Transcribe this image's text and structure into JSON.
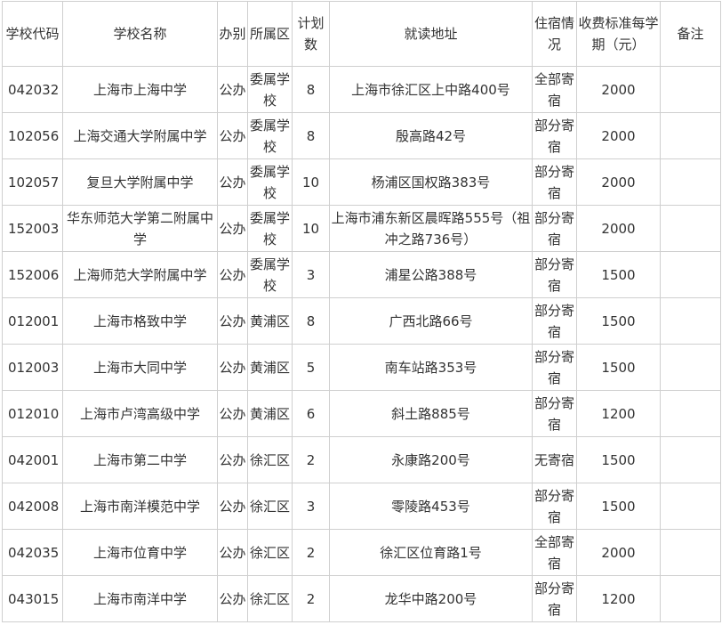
{
  "headers": {
    "code": "学校代码",
    "name": "学校名称",
    "type": "办别",
    "district": "所属区",
    "plan": "计划数",
    "address": "就读地址",
    "boarding": "住宿情况",
    "fee": "收费标准每学期（元）",
    "remark": "备注"
  },
  "rows": [
    {
      "code": "042032",
      "name": "上海市上海中学",
      "type": "公办",
      "district": "委属学校",
      "plan": "8",
      "address": "上海市徐汇区上中路400号",
      "boarding": "全部寄宿",
      "fee": "2000",
      "remark": ""
    },
    {
      "code": "102056",
      "name": "上海交通大学附属中学",
      "type": "公办",
      "district": "委属学校",
      "plan": "8",
      "address": "殷高路42号",
      "boarding": "部分寄宿",
      "fee": "2000",
      "remark": ""
    },
    {
      "code": "102057",
      "name": "复旦大学附属中学",
      "type": "公办",
      "district": "委属学校",
      "plan": "10",
      "address": "杨浦区国权路383号",
      "boarding": "部分寄宿",
      "fee": "2000",
      "remark": ""
    },
    {
      "code": "152003",
      "name": "华东师范大学第二附属中学",
      "type": "公办",
      "district": "委属学校",
      "plan": "10",
      "address": "上海市浦东新区晨晖路555号（祖冲之路736号）",
      "boarding": "部分寄宿",
      "fee": "2000",
      "remark": ""
    },
    {
      "code": "152006",
      "name": "上海师范大学附属中学",
      "type": "公办",
      "district": "委属学校",
      "plan": "3",
      "address": "浦星公路388号",
      "boarding": "部分寄宿",
      "fee": "1500",
      "remark": ""
    },
    {
      "code": "012001",
      "name": "上海市格致中学",
      "type": "公办",
      "district": "黄浦区",
      "plan": "8",
      "address": "广西北路66号",
      "boarding": "部分寄宿",
      "fee": "1500",
      "remark": ""
    },
    {
      "code": "012003",
      "name": "上海市大同中学",
      "type": "公办",
      "district": "黄浦区",
      "plan": "5",
      "address": "南车站路353号",
      "boarding": "部分寄宿",
      "fee": "1500",
      "remark": ""
    },
    {
      "code": "012010",
      "name": "上海市卢湾高级中学",
      "type": "公办",
      "district": "黄浦区",
      "plan": "6",
      "address": "斜土路885号",
      "boarding": "部分寄宿",
      "fee": "1200",
      "remark": ""
    },
    {
      "code": "042001",
      "name": "上海市第二中学",
      "type": "公办",
      "district": "徐汇区",
      "plan": "2",
      "address": "永康路200号",
      "boarding": "无寄宿",
      "fee": "1500",
      "remark": ""
    },
    {
      "code": "042008",
      "name": "上海市南洋模范中学",
      "type": "公办",
      "district": "徐汇区",
      "plan": "3",
      "address": "零陵路453号",
      "boarding": "部分寄宿",
      "fee": "1500",
      "remark": ""
    },
    {
      "code": "042035",
      "name": "上海市位育中学",
      "type": "公办",
      "district": "徐汇区",
      "plan": "2",
      "address": "徐汇区位育路1号",
      "boarding": "全部寄宿",
      "fee": "2000",
      "remark": ""
    },
    {
      "code": "043015",
      "name": "上海市南洋中学",
      "type": "公办",
      "district": "徐汇区",
      "plan": "2",
      "address": "龙华中路200号",
      "boarding": "部分寄宿",
      "fee": "1200",
      "remark": ""
    }
  ]
}
